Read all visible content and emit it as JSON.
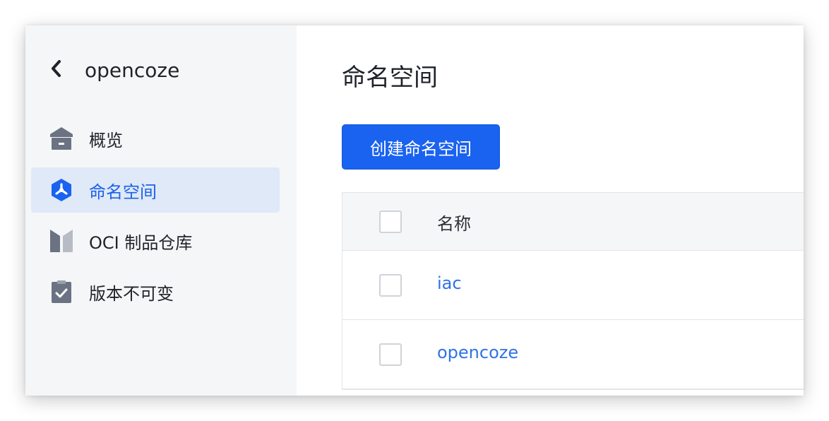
{
  "sidebar": {
    "back_icon": "chevron-left-icon",
    "title": "opencoze",
    "items": [
      {
        "label": "概览",
        "icon": "home-icon",
        "active": false
      },
      {
        "label": "命名空间",
        "icon": "namespace-icon",
        "active": true
      },
      {
        "label": "OCI 制品仓库",
        "icon": "oci-repository-icon",
        "active": false
      },
      {
        "label": "版本不可变",
        "icon": "immutable-check-icon",
        "active": false
      }
    ]
  },
  "main": {
    "title": "命名空间",
    "create_button": "创建命名空间",
    "table": {
      "columns": [
        "名称"
      ],
      "rows": [
        {
          "name": "iac"
        },
        {
          "name": "opencoze"
        }
      ]
    }
  },
  "colors": {
    "accent": "#1a62f0",
    "link": "#2f73e4",
    "active_bg": "#e0e9f8",
    "sidebar_bg": "#f5f6f8"
  }
}
